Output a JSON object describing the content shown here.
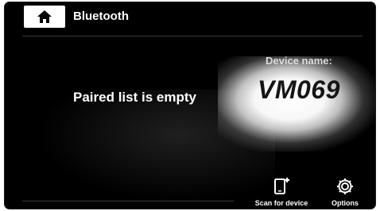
{
  "header": {
    "title": "Bluetooth",
    "home_icon": "home-icon"
  },
  "main": {
    "empty_message": "Paired list is empty",
    "device_name_label": "Device name:",
    "device_name": "VM069"
  },
  "actions": [
    {
      "label": "Scan for device",
      "icon": "scan-device-icon"
    },
    {
      "label": "Options",
      "icon": "gear-icon"
    }
  ],
  "colors": {
    "background": "#000000",
    "text": "#ffffff",
    "device_name": "#151515",
    "glow": "#ffffff"
  }
}
